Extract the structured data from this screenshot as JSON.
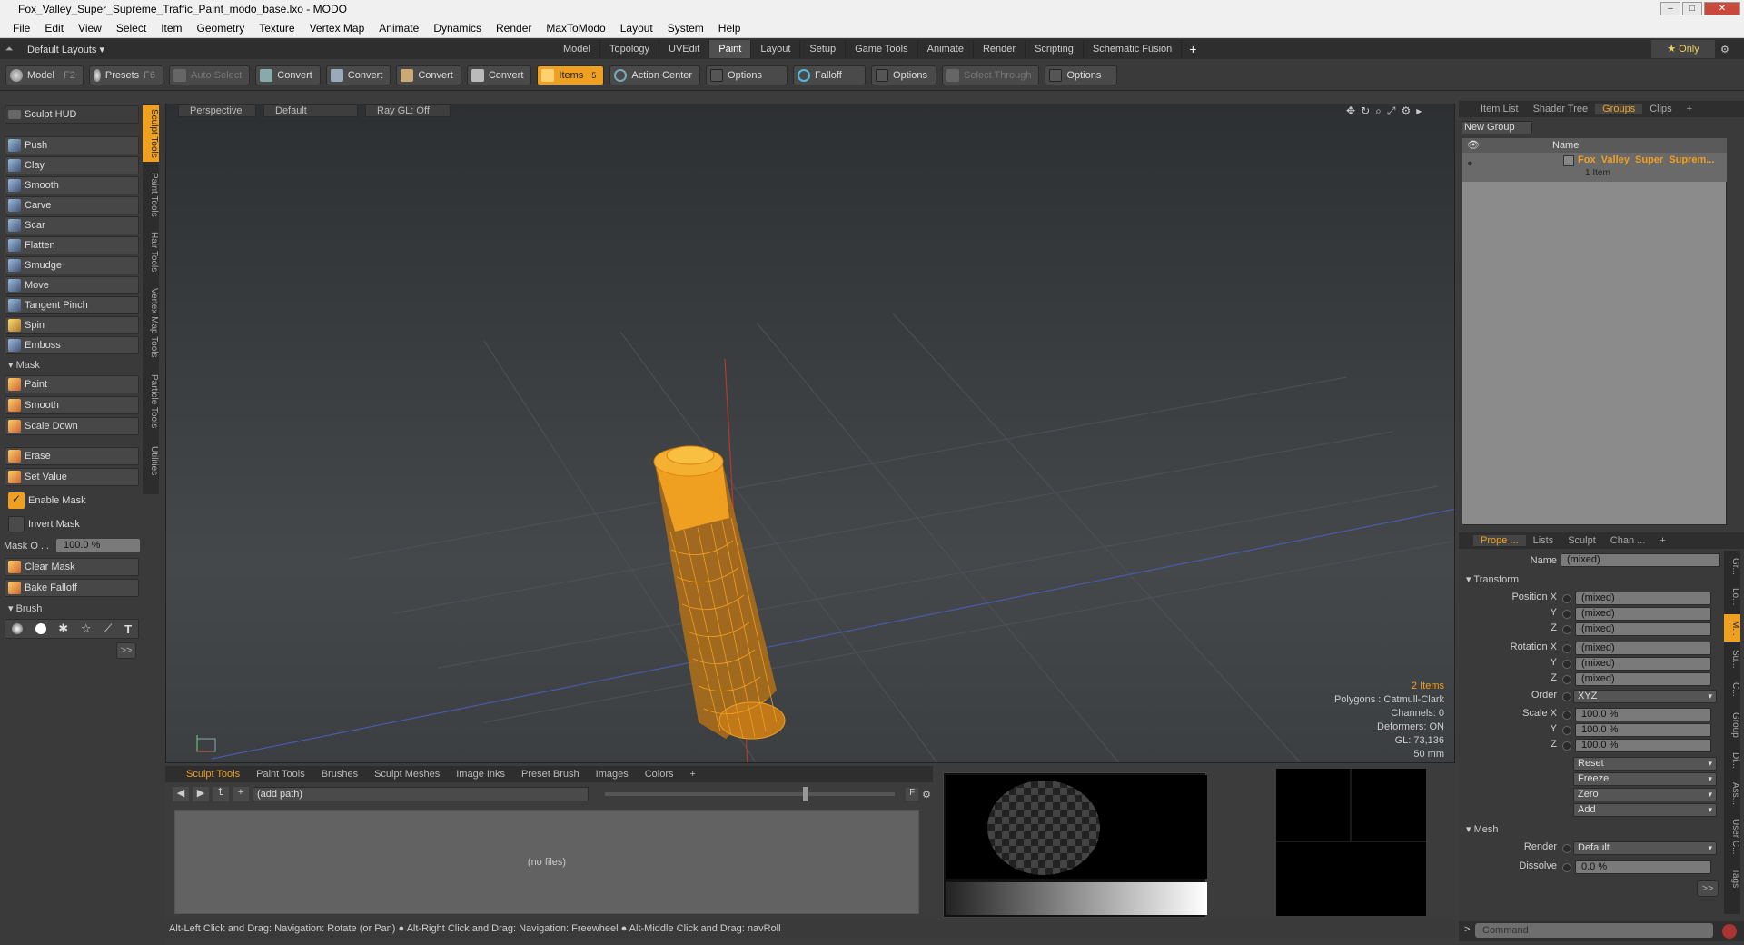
{
  "window": {
    "title": "Fox_Valley_Super_Supreme_Traffic_Paint_modo_base.lxo - MODO"
  },
  "menu": [
    "File",
    "Edit",
    "View",
    "Select",
    "Item",
    "Geometry",
    "Texture",
    "Vertex Map",
    "Animate",
    "Dynamics",
    "Render",
    "MaxToModo",
    "Layout",
    "System",
    "Help"
  ],
  "layoutbar": {
    "layout_name": "Default Layouts ▾",
    "tabs": [
      "Model",
      "Topology",
      "UVEdit",
      "Paint",
      "Layout",
      "Setup",
      "Game Tools",
      "Animate",
      "Render",
      "Scripting",
      "Schematic Fusion"
    ],
    "active_tab": "Paint",
    "only_label": "★ Only"
  },
  "toolbar": {
    "model": "Model",
    "model_key": "F2",
    "presets": "Presets",
    "presets_key": "F6",
    "auto_select": "Auto Select",
    "convert1": "Convert",
    "convert2": "Convert",
    "convert3": "Convert",
    "convert4": "Convert",
    "items": "Items",
    "items_count": "5",
    "action_center": "Action Center",
    "options1": "Options",
    "falloff": "Falloff",
    "options2": "Options",
    "select_through": "Select Through",
    "options3": "Options"
  },
  "left": {
    "sculpt_hud": "Sculpt HUD",
    "tools": [
      "Push",
      "Clay",
      "Smooth",
      "Carve",
      "Scar",
      "Flatten",
      "Smudge",
      "Move",
      "Tangent Pinch",
      "Spin",
      "Emboss"
    ],
    "mask_section": "Mask",
    "mask_tools": [
      "Paint",
      "Smooth",
      "Scale Down"
    ],
    "erase": "Erase",
    "set_value": "Set Value",
    "enable_mask": "Enable Mask",
    "invert_mask": "Invert Mask",
    "mask_opacity_label": "Mask O ...",
    "mask_opacity_value": "100.0 %",
    "clear_mask": "Clear Mask",
    "bake_falloff": "Bake Falloff",
    "brush_section": "Brush",
    "more": ">>",
    "vtabs": [
      "Sculpt Tools",
      "Paint Tools",
      "Hair Tools",
      "Vertex Map Tools",
      "Particle Tools",
      "Utilities"
    ]
  },
  "viewport": {
    "view": "Perspective",
    "shading": "Default",
    "raygl": "Ray GL: Off",
    "info": {
      "items": "2 Items",
      "polygons": "Polygons : Catmull-Clark",
      "channels": "Channels: 0",
      "deformers": "Deformers: ON",
      "gl": "GL: 73,136",
      "scale": "50 mm"
    }
  },
  "bottom": {
    "tabs": [
      "Sculpt Tools",
      "Paint Tools",
      "Brushes",
      "Sculpt Meshes",
      "Image Inks",
      "Preset Brush",
      "Images",
      "Colors",
      "+"
    ],
    "active_tab": "Sculpt Tools",
    "path": "(add path)",
    "empty": "(no files)",
    "f_label": "F"
  },
  "status": "Alt-Left Click and Drag: Navigation: Rotate (or Pan) ● Alt-Right Click and Drag: Navigation: Freewheel ● Alt-Middle Click and Drag: navRoll",
  "right_top": {
    "tabs": [
      "Item List",
      "Shader Tree",
      "Groups",
      "Clips",
      "+"
    ],
    "active_tab": "Groups",
    "new_group": "New Group",
    "col_name": "Name",
    "group_name": "Fox_Valley_Super_Suprem...",
    "group_items": "1 Item"
  },
  "properties": {
    "tabs": [
      "Prope ...",
      "Lists",
      "Sculpt",
      "Chan ...",
      "+"
    ],
    "active_tab": "Prope ...",
    "name_label": "Name",
    "name_value": "(mixed)",
    "transform": "Transform",
    "position_x_label": "Position X",
    "position_x": "(mixed)",
    "position_y_label": "Y",
    "position_y": "(mixed)",
    "position_z_label": "Z",
    "position_z": "(mixed)",
    "rotation_x_label": "Rotation X",
    "rotation_x": "(mixed)",
    "rotation_y_label": "Y",
    "rotation_y": "(mixed)",
    "rotation_z_label": "Z",
    "rotation_z": "(mixed)",
    "order_label": "Order",
    "order": "XYZ",
    "scale_x_label": "Scale X",
    "scale_x": "100.0 %",
    "scale_y_label": "Y",
    "scale_y": "100.0 %",
    "scale_z_label": "Z",
    "scale_z": "100.0 %",
    "reset": "Reset",
    "freeze": "Freeze",
    "zero": "Zero",
    "add": "Add",
    "mesh": "Mesh",
    "render_label": "Render",
    "render": "Default",
    "dissolve_label": "Dissolve",
    "dissolve": "0.0 %",
    "more": ">>",
    "vtabs": [
      "Gr...",
      "Lo...",
      "M...",
      "Su...",
      "C...",
      "Group",
      "Di...",
      "Ass...",
      "User C...",
      "Tags"
    ]
  },
  "command": {
    "prompt": ">",
    "placeholder": "Command"
  },
  "colors": {
    "accent": "#f0a020",
    "panel": "#3a3a3a",
    "field": "#7a7a7a"
  }
}
